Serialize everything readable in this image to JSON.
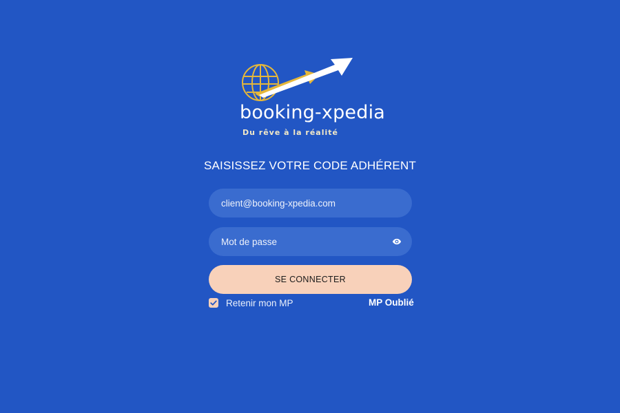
{
  "brand": {
    "name": "booking-xpedia",
    "tagline": "Du rêve à la réalité",
    "logo_icon": "globe-arrow-logo",
    "colors": {
      "gold": "#e5b73a",
      "white": "#ffffff"
    }
  },
  "form": {
    "heading": "SAISISSEZ VOTRE CODE ADHÉRENT",
    "email_placeholder": "client@booking-xpedia.com",
    "password_placeholder": "Mot de passe",
    "password_toggle_icon": "eye-icon",
    "submit_label": "SE CONNECTER",
    "remember_label": "Retenir mon MP",
    "remember_checked": true,
    "forgot_label": "MP Oublié"
  },
  "theme": {
    "background": "#2256c4",
    "field_background": "#3a6ccf",
    "button_background": "#f8d1ba"
  }
}
